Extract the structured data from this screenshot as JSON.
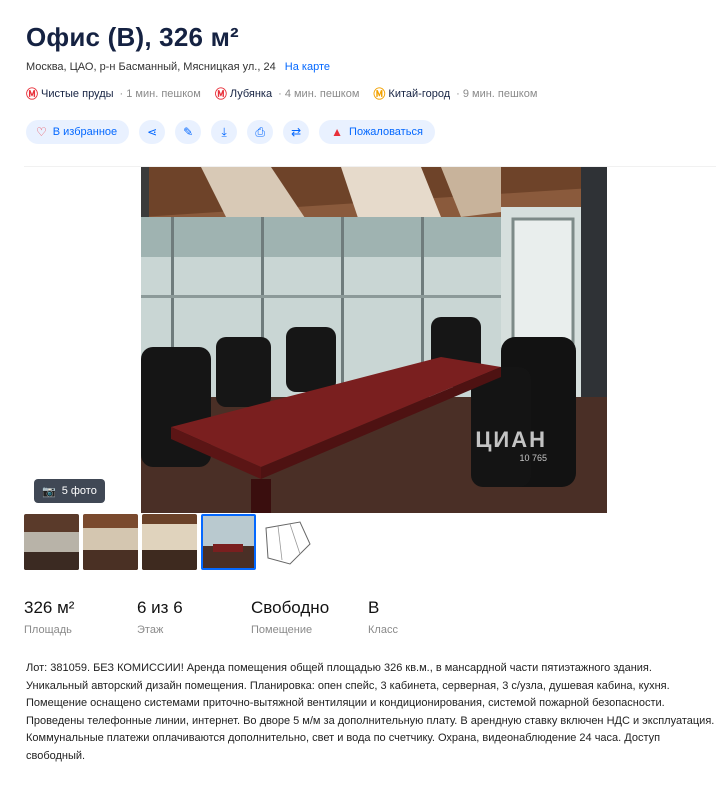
{
  "listing": {
    "title": "Офис (B), 326 м²",
    "address": "Москва, ЦАО, р-н Басманный, Мясницкая ул., 24",
    "map_link": "На карте"
  },
  "metro": [
    {
      "name": "Чистые пруды",
      "walk": "· 1 мин. пешком",
      "color": "#e8303a"
    },
    {
      "name": "Лубянка",
      "walk": "· 4 мин. пешком",
      "color": "#e8303a"
    },
    {
      "name": "Китай-город",
      "walk": "· 9 мин. пешком",
      "color": "#f2a100"
    }
  ],
  "actions": {
    "favorite_label": "В избранное",
    "complain_label": "Пожаловаться",
    "icons": [
      "share-icon",
      "edit-icon",
      "download-icon",
      "print-icon",
      "compare-icon"
    ]
  },
  "gallery": {
    "photo_count": "5 фото",
    "watermark": "ЦИАН",
    "watermark_id": "10 765"
  },
  "stats": [
    {
      "value": "326 м²",
      "label": "Площадь"
    },
    {
      "value": "6 из 6",
      "label": "Этаж"
    },
    {
      "value": "Свободно",
      "label": "Помещение"
    },
    {
      "value": "B",
      "label": "Класс"
    }
  ],
  "description": "Лот: 381059. БЕЗ КОМИССИИ! Аренда помещения общей площадью 326 кв.м., в мансардной части пятиэтажного здания. Уникальный авторский дизайн помещения. Планировка: опен спейс, 3 кабинета, серверная, 3 с/узла, душевая кабина, кухня. Помещение оснащено системами приточно-вытяжной вентиляции и кондиционирования, системой пожарной безопасности. Проведены телефонные линии, интернет. Во дворе 5 м/м за дополнительную плату. В арендную ставку включен НДС и эксплуатация. Коммунальные платежи оплачиваются дополнительно, свет и вода по счетчику. Охрана, видеонаблюдение 24 часа. Доступ свободный.",
  "colors": {
    "accent": "#0468ff",
    "title": "#152242",
    "favorite": "#e8303a"
  }
}
